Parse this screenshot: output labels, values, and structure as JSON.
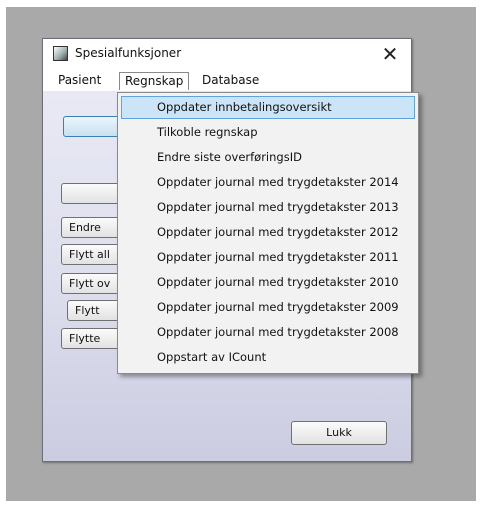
{
  "window": {
    "title": "Spesialfunksjoner",
    "close_glyph": "✕"
  },
  "menubar": {
    "items": [
      "Pasient",
      "Regnskap",
      "Database"
    ],
    "active": "Regnskap"
  },
  "buttons": {
    "b1": "",
    "b2": "",
    "b3": "Endre",
    "b4": "Flytt all",
    "b5": "Flytt ov",
    "b6": "Flytt",
    "b7": "Flytte",
    "close": "Lukk"
  },
  "regnskap_menu": {
    "items": [
      "Oppdater innbetalingsoversikt",
      "Tilkoble regnskap",
      "Endre siste overføringsID",
      "Oppdater journal med trygdetakster 2014",
      "Oppdater journal med trygdetakster 2013",
      "Oppdater journal med trygdetakster 2012",
      "Oppdater journal med trygdetakster 2011",
      "Oppdater journal med trygdetakster 2010",
      "Oppdater journal med trygdetakster 2009",
      "Oppdater journal med trygdetakster 2008",
      "Oppstart av ICount"
    ],
    "highlighted_index": 0
  },
  "colors": {
    "highlight": "#cce4f7",
    "highlight_border": "#5fa2dc",
    "backdrop": "#a9a9a9"
  },
  "icons": {
    "app": "app-icon",
    "close": "close-icon"
  }
}
